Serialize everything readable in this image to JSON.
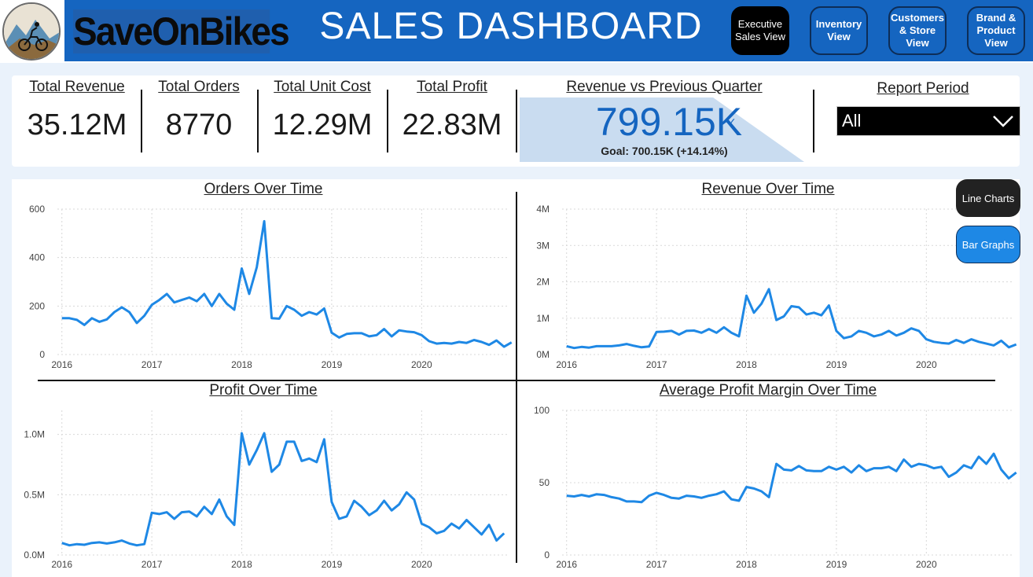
{
  "header": {
    "brand": "SaveOnBikes",
    "title": "SALES DASHBOARD",
    "nav": [
      {
        "label": "Executive\nSales View",
        "active": true
      },
      {
        "label": "Inventory\nView",
        "active": false
      },
      {
        "label": "Customers\n& Store\nView",
        "active": false
      },
      {
        "label": "Brand &\nProduct\nView",
        "active": false
      }
    ]
  },
  "kpis": {
    "revenue": {
      "label": "Total Revenue",
      "value": "35.12M"
    },
    "orders": {
      "label": "Total Orders",
      "value": "8770"
    },
    "unit_cost": {
      "label": "Total Unit Cost",
      "value": "12.29M"
    },
    "profit": {
      "label": "Total Profit",
      "value": "22.83M"
    }
  },
  "gauge": {
    "label": "Revenue vs Previous Quarter",
    "value": "799.15K",
    "goal": "Goal: 700.15K (+14.14%)",
    "fill_color": "#c9dcf0"
  },
  "report_period": {
    "label": "Report Period",
    "selected": "All"
  },
  "toggles": {
    "line": "Line Charts",
    "bar": "Bar Graphs"
  },
  "colors": {
    "header": "#1565c0",
    "line": "#1e88e5",
    "accent_dark": "#000000"
  },
  "chart_data": [
    {
      "type": "line",
      "title": "Orders Over Time",
      "x_tick_labels": [
        "2016",
        "2017",
        "2018",
        "2019",
        "2020"
      ],
      "y_tick_labels": [
        "0",
        "200",
        "400",
        "600"
      ],
      "ylim": [
        0,
        600
      ],
      "x_start": 2016.0,
      "x_step": 0.08333,
      "values": [
        150,
        150,
        143,
        122,
        150,
        135,
        145,
        175,
        195,
        175,
        130,
        160,
        205,
        225,
        250,
        215,
        225,
        235,
        220,
        250,
        200,
        250,
        210,
        185,
        355,
        250,
        360,
        550,
        150,
        148,
        200,
        185,
        160,
        175,
        165,
        190,
        90,
        70,
        85,
        88,
        88,
        75,
        80,
        105,
        75,
        100,
        95,
        92,
        80,
        55,
        45,
        48,
        45,
        52,
        48,
        60,
        52,
        40,
        58,
        32,
        50
      ]
    },
    {
      "type": "line",
      "title": "Revenue Over Time",
      "x_tick_labels": [
        "2016",
        "2017",
        "2018",
        "2019",
        "2020"
      ],
      "y_tick_labels": [
        "0M",
        "1M",
        "2M",
        "3M",
        "4M"
      ],
      "ylim": [
        0,
        4000000
      ],
      "x_start": 2016.0,
      "x_step": 0.08333,
      "values": [
        230000,
        180000,
        210000,
        190000,
        230000,
        230000,
        230000,
        250000,
        290000,
        240000,
        200000,
        220000,
        620000,
        630000,
        650000,
        550000,
        650000,
        660000,
        600000,
        700000,
        600000,
        750000,
        600000,
        500000,
        1620000,
        1150000,
        1400000,
        1800000,
        950000,
        1050000,
        1330000,
        1300000,
        1100000,
        1150000,
        1080000,
        1350000,
        650000,
        450000,
        500000,
        650000,
        600000,
        500000,
        550000,
        650000,
        520000,
        600000,
        720000,
        650000,
        420000,
        350000,
        320000,
        300000,
        400000,
        320000,
        420000,
        350000,
        300000,
        250000,
        380000,
        200000,
        280000
      ]
    },
    {
      "type": "line",
      "title": "Profit Over Time",
      "x_tick_labels": [
        "2016",
        "2017",
        "2018",
        "2019",
        "2020"
      ],
      "y_tick_labels": [
        "0.0M",
        "0.5M",
        "1.0M"
      ],
      "ylim": [
        0,
        1200000
      ],
      "x_start": 2016.0,
      "x_step": 0.08333,
      "values": [
        100000,
        80000,
        90000,
        85000,
        100000,
        105000,
        95000,
        105000,
        120000,
        95000,
        80000,
        90000,
        350000,
        340000,
        355000,
        300000,
        355000,
        360000,
        320000,
        400000,
        340000,
        460000,
        320000,
        250000,
        1010000,
        750000,
        870000,
        1010000,
        690000,
        750000,
        940000,
        940000,
        780000,
        800000,
        770000,
        960000,
        440000,
        300000,
        320000,
        450000,
        400000,
        330000,
        370000,
        450000,
        370000,
        420000,
        520000,
        460000,
        260000,
        230000,
        180000,
        200000,
        260000,
        220000,
        290000,
        230000,
        170000,
        250000,
        120000,
        180000
      ]
    },
    {
      "type": "line",
      "title": "Average Profit Margin Over Time",
      "x_tick_labels": [
        "2016",
        "2017",
        "2018",
        "2019",
        "2020"
      ],
      "y_tick_labels": [
        "0",
        "50",
        "100"
      ],
      "ylim": [
        0,
        100
      ],
      "x_start": 2016.0,
      "x_step": 0.08333,
      "values": [
        41,
        40.5,
        41.5,
        40.5,
        42,
        41.5,
        40,
        39,
        37,
        37,
        36.5,
        41,
        43,
        41.5,
        39.5,
        39,
        41,
        40.5,
        39.5,
        41,
        42,
        44,
        38.5,
        37.5,
        47,
        46,
        44,
        40,
        63,
        59,
        58.5,
        61.5,
        58.5,
        58,
        58,
        61,
        59,
        61,
        57,
        62,
        58,
        60,
        60,
        61,
        58,
        66,
        61,
        63,
        62,
        60,
        61,
        54,
        57,
        62,
        60,
        68,
        63,
        70,
        59,
        53,
        57
      ]
    }
  ]
}
